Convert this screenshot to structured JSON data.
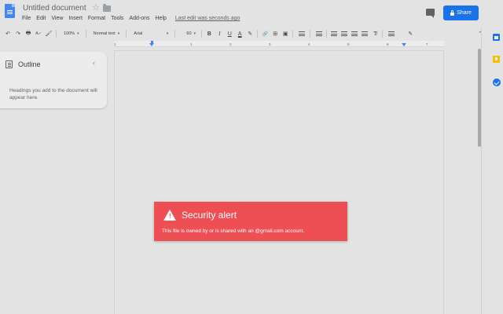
{
  "document": {
    "title": "Untitled document",
    "last_edit": "Last edit was seconds ago"
  },
  "menu": [
    "File",
    "Edit",
    "View",
    "Insert",
    "Format",
    "Tools",
    "Add-ons",
    "Help"
  ],
  "share": {
    "label": "Share",
    "color": "#1a73e8"
  },
  "toolbar": {
    "zoom": "100%",
    "style": "Normal text",
    "font": "Arial",
    "font_size": "60"
  },
  "ruler": {
    "ticks": [
      "1",
      "1",
      "2",
      "3",
      "4",
      "5",
      "6",
      "7"
    ]
  },
  "outline": {
    "title": "Outline",
    "hint": "Headings you add to the document will appear here."
  },
  "alert": {
    "title": "Security alert",
    "message": "This file is owned by or is shared with an @gmail.com account.",
    "background": "#ee4f55"
  },
  "icons": {
    "undo": "↶",
    "redo": "↷",
    "print": "🖶",
    "spellcheck": "A✓",
    "paint_format": "🖌",
    "bold": "B",
    "italic": "I",
    "underline": "U",
    "text_color": "A",
    "highlight": "✎",
    "link": "🔗",
    "comment": "⊞",
    "image": "▣",
    "clear_format": "T̸",
    "edit_mode": "✎",
    "star": "☆",
    "collapse": "⌃",
    "outline_close": "‹",
    "warning_mark": "!"
  }
}
